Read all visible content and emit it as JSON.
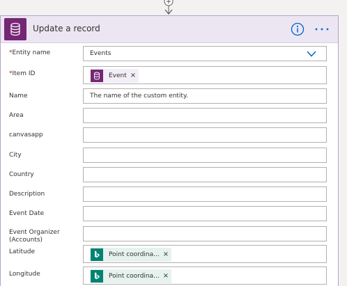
{
  "card": {
    "title": "Update a record",
    "accent_color": "#742774"
  },
  "fields": {
    "entity_name": {
      "label": "Entity name",
      "required_mark": "*",
      "value": "Events"
    },
    "item_id": {
      "label": "Item ID",
      "required_mark": "*",
      "token": "Event",
      "token_close": "×"
    },
    "name": {
      "label": "Name",
      "placeholder": "The name of the custom entity."
    },
    "area": {
      "label": "Area"
    },
    "canvasapp": {
      "label": "canvasapp"
    },
    "city": {
      "label": "City"
    },
    "country": {
      "label": "Country"
    },
    "description": {
      "label": "Description"
    },
    "event_date": {
      "label": "Event Date"
    },
    "event_organizer": {
      "label_line1": "Event Organizer",
      "label_line2": "(Accounts)"
    },
    "latitude": {
      "label": "Latitude",
      "token": "Point coordina...",
      "token_close": "×"
    },
    "longitude": {
      "label": "Longitude",
      "token": "Point coordina...",
      "token_close": "×"
    }
  },
  "icons": {
    "connector": "add-step-icon",
    "action": "database-icon",
    "info": "info-icon",
    "more": "more-options-icon",
    "dropdown": "chevron-down-icon",
    "bing": "bing-maps-icon"
  }
}
